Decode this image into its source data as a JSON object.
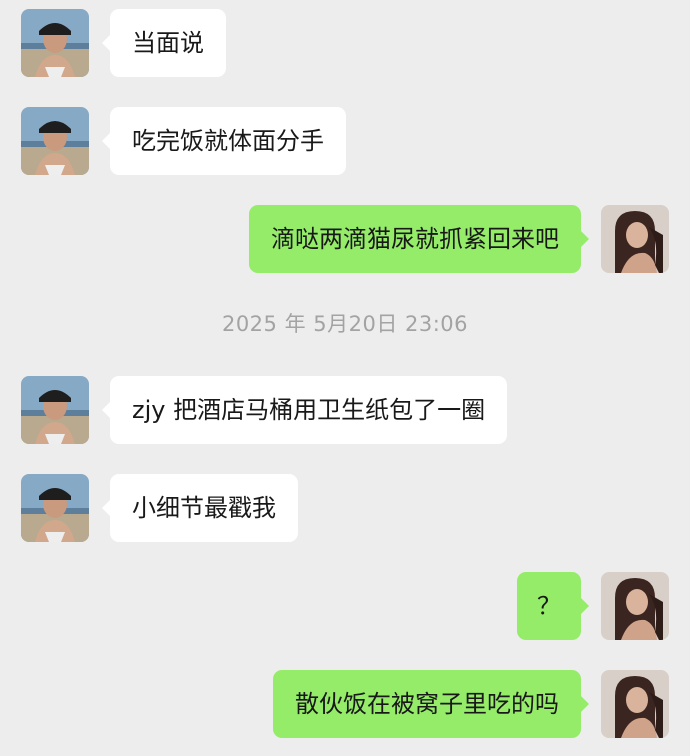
{
  "chat": {
    "messages": [
      {
        "side": "in",
        "text": "当面说"
      },
      {
        "side": "in",
        "text": "吃完饭就体面分手"
      },
      {
        "side": "out",
        "text": "滴哒两滴猫尿就抓紧回来吧"
      },
      {
        "side": "in",
        "text": "zjy 把酒店马桶用卫生纸包了一圈"
      },
      {
        "side": "in",
        "text": "小细节最戳我"
      },
      {
        "side": "out",
        "text": "？"
      },
      {
        "side": "out",
        "text": "散伙饭在被窝子里吃的吗"
      }
    ],
    "timestamp": "2025 年 5月20日 23:06"
  },
  "colors": {
    "background": "#ededed",
    "incoming_bubble": "#ffffff",
    "outgoing_bubble": "#95ec69",
    "timestamp_text": "#a3a3a3"
  },
  "icons": {
    "contact_avatar": "contact-avatar-icon",
    "self_avatar": "self-avatar-icon"
  }
}
